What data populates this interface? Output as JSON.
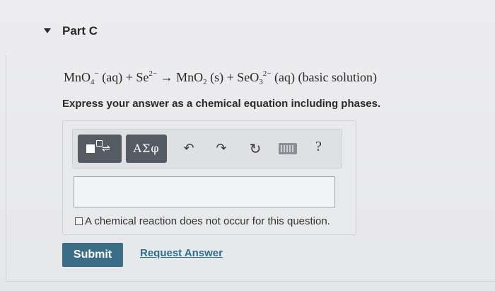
{
  "part": {
    "title": "Part C"
  },
  "equation": {
    "mno": "MnO",
    "sub4": "4",
    "sup_minus": "−",
    "aq1": "(aq) + Se",
    "sup_2minus": "2−",
    "arrow": " → MnO",
    "sub2a": "2",
    "s": "(s) + SeO",
    "sub3": "3",
    "sup_2minus_b": "2−",
    "aq2": "(aq) (basic solution)"
  },
  "instruction": "Express your answer as a chemical equation including phases.",
  "toolbar": {
    "template_icon": "template-icon",
    "greek_label": "ΑΣφ",
    "undo_icon": "undo-icon",
    "redo_icon": "redo-icon",
    "reset_icon": "reset-icon",
    "keyboard_icon": "keyboard-icon",
    "help_label": "?"
  },
  "answer": {
    "value": ""
  },
  "no_reaction_label": "A chemical reaction does not occur for this question.",
  "actions": {
    "submit_label": "Submit",
    "request_label": "Request Answer"
  },
  "colors": {
    "accent": "#3a6e86",
    "link": "#2f6f8f",
    "toolbar_button": "#555b63"
  }
}
